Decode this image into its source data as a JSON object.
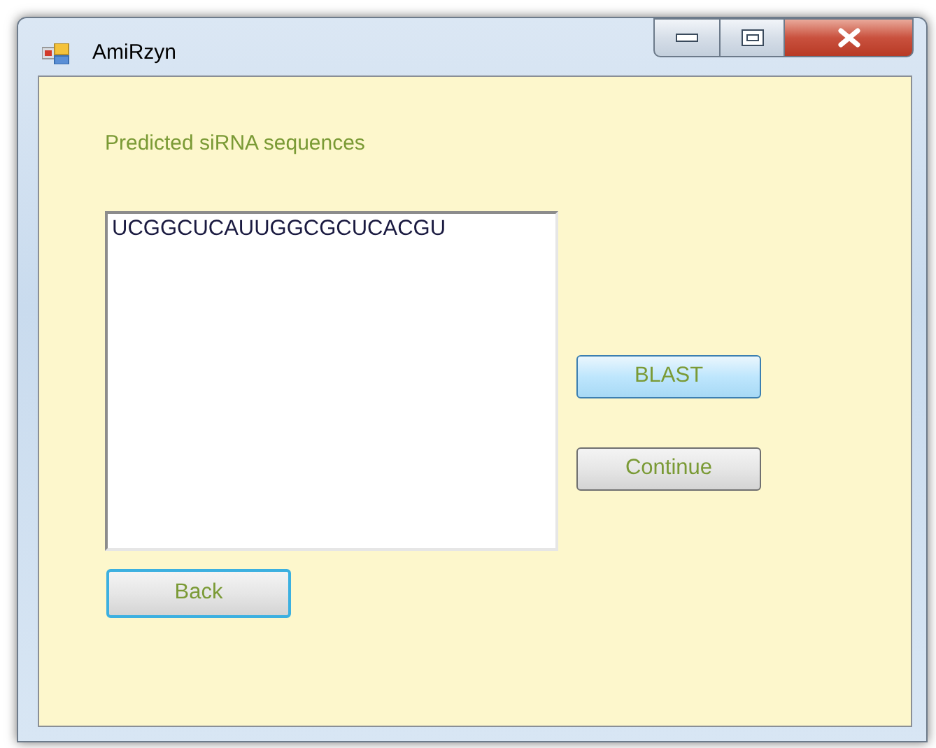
{
  "window": {
    "title": "AmiRzyn"
  },
  "label": "Predicted siRNA sequences",
  "sequences": [
    {
      "text": "UCGGCUCAUUGGCGCUCACGU",
      "selected": false
    }
  ],
  "side_buttons": [
    {
      "label": "BLAST",
      "hovered": true,
      "focused": false
    },
    {
      "label": "Continue",
      "hovered": false,
      "focused": false
    }
  ],
  "back_button": {
    "label": "Back",
    "hovered": false,
    "focused": true
  }
}
